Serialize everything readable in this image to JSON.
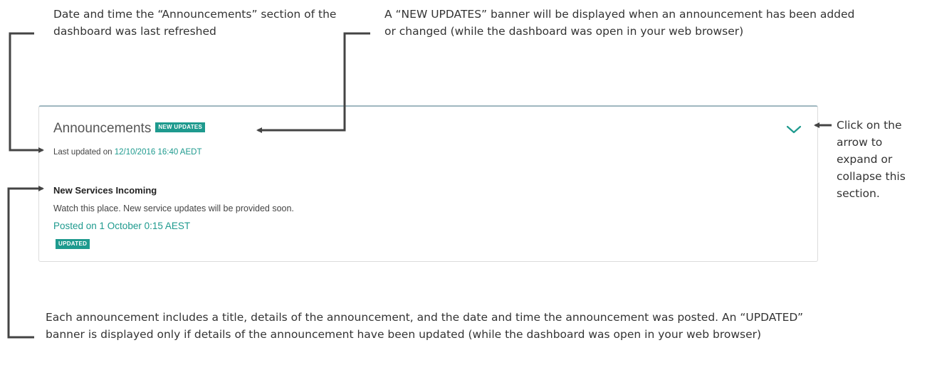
{
  "annotations": {
    "date_note": "Date and time the “Announcements” section of the dashboard  was last refreshed",
    "banner_note": "A “NEW UPDATES” banner will be displayed when an announcement has been added or changed (while the dashboard was open in your web browser)",
    "arrow_note": "Click on the arrow to expand or collapse this section.",
    "announcement_note": "Each announcement includes a title, details of the announcement, and the date and time the announcement was posted. An “UPDATED” banner is displayed only if details of the announcement have been updated (while the dashboard was open in your web browser)"
  },
  "panel": {
    "title": "Announcements",
    "new_updates_badge": "NEW UPDATES",
    "last_updated_label": "Last updated on",
    "last_updated_value": "12/10/2016 16:40 AEDT",
    "toggle_icon": "chevron-down-icon"
  },
  "announcements": [
    {
      "title": "New Services Incoming",
      "body": "Watch this place. New service updates will be provided soon.",
      "posted": "Posted on 1 October 0:15 AEST",
      "badge": "UPDATED"
    }
  ],
  "colors": {
    "accent": "#1e9a8e",
    "panel_border_top": "#9fb7bf",
    "pointer_lines": "#444444"
  }
}
